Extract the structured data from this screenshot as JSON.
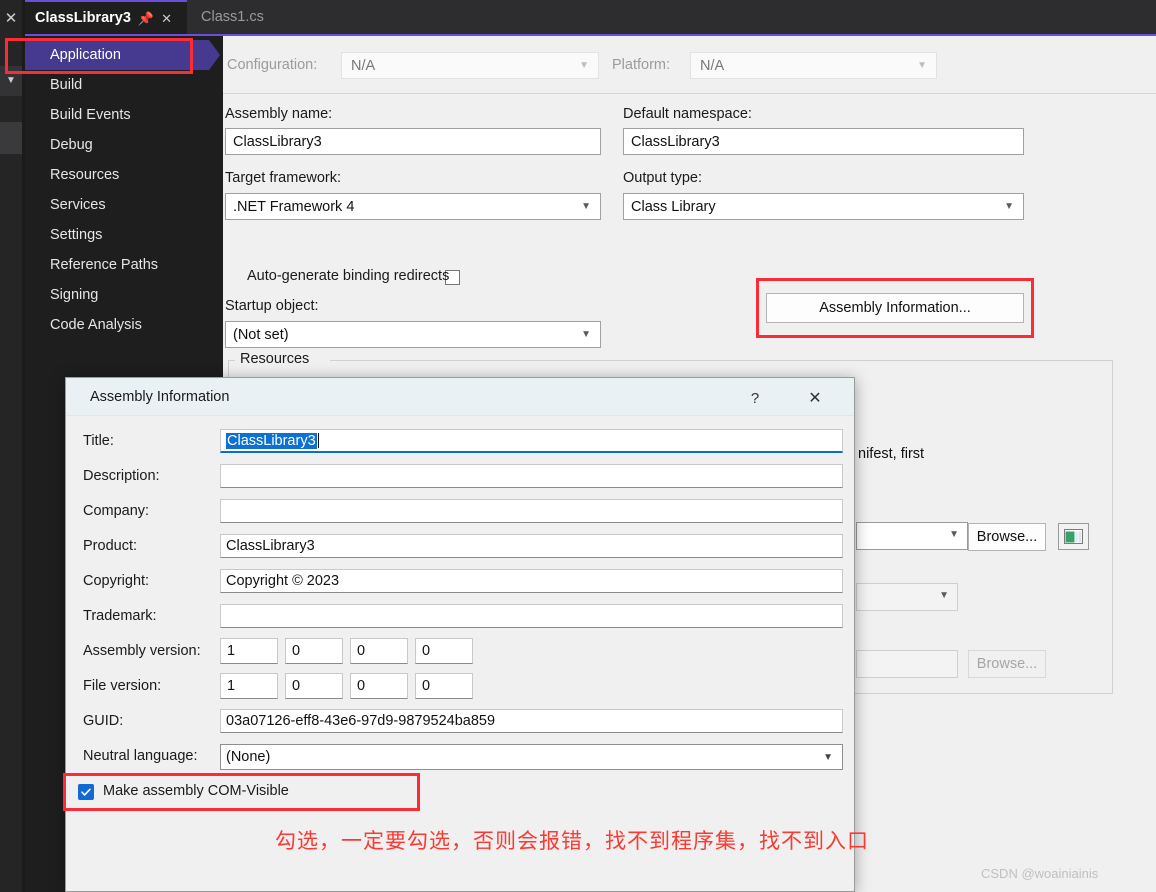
{
  "window": {
    "tabs": [
      {
        "label": "ClassLibrary3",
        "active": true,
        "pin_icon": "pin-icon",
        "close_icon": "close-icon"
      },
      {
        "label": "Class1.cs",
        "active": false
      }
    ],
    "rail": {
      "close_icon": "close-icon",
      "dropdown_icon": "chevron-down-icon"
    }
  },
  "sidebar": {
    "items": [
      {
        "label": "Application",
        "selected": true
      },
      {
        "label": "Build",
        "selected": false
      },
      {
        "label": "Build Events",
        "selected": false
      },
      {
        "label": "Debug",
        "selected": false
      },
      {
        "label": "Resources",
        "selected": false
      },
      {
        "label": "Services",
        "selected": false
      },
      {
        "label": "Settings",
        "selected": false
      },
      {
        "label": "Reference Paths",
        "selected": false
      },
      {
        "label": "Signing",
        "selected": false
      },
      {
        "label": "Code Analysis",
        "selected": false
      }
    ]
  },
  "properties": {
    "configuration_label": "Configuration:",
    "configuration_value": "N/A",
    "platform_label": "Platform:",
    "platform_value": "N/A",
    "assembly_name_label": "Assembly name:",
    "assembly_name_value": "ClassLibrary3",
    "default_namespace_label": "Default namespace:",
    "default_namespace_value": "ClassLibrary3",
    "target_framework_label": "Target framework:",
    "target_framework_value": ".NET Framework 4",
    "output_type_label": "Output type:",
    "output_type_value": "Class Library",
    "auto_generate_label": "Auto-generate binding redirects",
    "auto_generate_checked": false,
    "startup_object_label": "Startup object:",
    "startup_object_value": "(Not set)",
    "assembly_information_button": "Assembly Information...",
    "resources_group_label": "Resources",
    "background_note": "nifest, first",
    "browse_button": "Browse...",
    "browse_button_disabled": "Browse..."
  },
  "dialog": {
    "title": "Assembly Information",
    "help_icon": "help-icon",
    "close_icon": "close-icon",
    "fields": {
      "title_label": "Title:",
      "title_value": "ClassLibrary3",
      "description_label": "Description:",
      "description_value": "",
      "company_label": "Company:",
      "company_value": "",
      "product_label": "Product:",
      "product_value": "ClassLibrary3",
      "copyright_label": "Copyright:",
      "copyright_value": "Copyright ©  2023",
      "trademark_label": "Trademark:",
      "trademark_value": "",
      "assembly_version_label": "Assembly version:",
      "assembly_version": [
        "1",
        "0",
        "0",
        "0"
      ],
      "file_version_label": "File version:",
      "file_version": [
        "1",
        "0",
        "0",
        "0"
      ],
      "guid_label": "GUID:",
      "guid_value": "03a07126-eff8-43e6-97d9-9879524ba859",
      "neutral_language_label": "Neutral language:",
      "neutral_language_value": "(None)",
      "com_visible_label": "Make assembly COM-Visible",
      "com_visible_checked": true
    }
  },
  "annotation": {
    "note_text": "勾选，一定要勾选，否则会报错，找不到程序集，找不到入口",
    "highlight_color": "#fb2c36",
    "note_color": "#fb3a33"
  },
  "watermark": {
    "text": "CSDN @woainiainis"
  }
}
